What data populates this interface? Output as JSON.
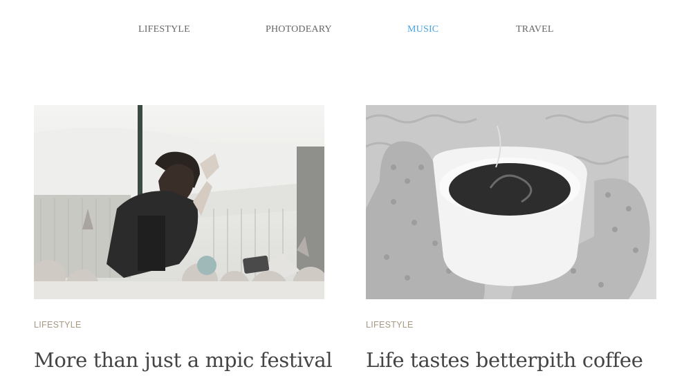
{
  "nav": {
    "items": [
      {
        "label": "LIFESTYLE",
        "active": false
      },
      {
        "label": "PHOTODEARY",
        "active": false
      },
      {
        "label": "MUSIC",
        "active": true
      },
      {
        "label": "TRAVEL",
        "active": false
      }
    ],
    "active_color": "#4aa3df"
  },
  "posts": [
    {
      "category": "LIFESTYLE",
      "title": "More than just a mpic festival",
      "image": "festival-crowd-photo"
    },
    {
      "category": "LIFESTYLE",
      "title": "Life tastes betterpith coffee",
      "image": "coffee-cup-mittens-photo"
    }
  ]
}
